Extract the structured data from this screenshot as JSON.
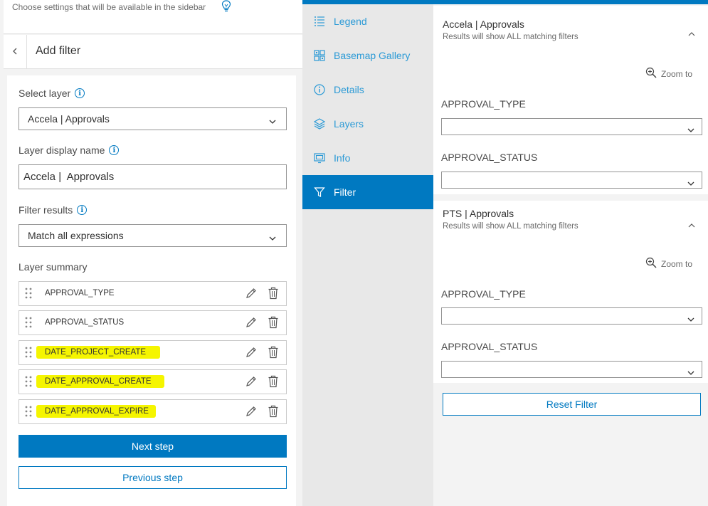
{
  "settings": {
    "hint": "Choose settings that will be available in the sidebar"
  },
  "filter_panel": {
    "title": "Add filter",
    "select_layer_label": "Select layer",
    "select_layer_value": "Accela | Approvals",
    "display_name_label": "Layer display name",
    "display_name_value": "Accela |  Approvals",
    "filter_results_label": "Filter results",
    "filter_results_value": "Match all expressions",
    "summary_label": "Layer summary",
    "expressions": [
      {
        "label": "APPROVAL_TYPE",
        "highlighted": false
      },
      {
        "label": "APPROVAL_STATUS",
        "highlighted": false
      },
      {
        "label": "DATE_PROJECT_CREATE",
        "highlighted": true
      },
      {
        "label": "DATE_APPROVAL_CREATE",
        "highlighted": true
      },
      {
        "label": "DATE_APPROVAL_EXPIRE",
        "highlighted": true
      }
    ],
    "next_label": "Next step",
    "previous_label": "Previous step",
    "highlight_color": "#f5f500",
    "accent_color": "#0079c1"
  },
  "nav": {
    "items": [
      {
        "label": "Legend",
        "icon": "legend-icon"
      },
      {
        "label": "Basemap Gallery",
        "icon": "basemap-gallery-icon"
      },
      {
        "label": "Details",
        "icon": "details-icon"
      },
      {
        "label": "Layers",
        "icon": "layers-icon"
      },
      {
        "label": "Info",
        "icon": "info-icon"
      },
      {
        "label": "Filter",
        "icon": "filter-icon",
        "active": true
      }
    ]
  },
  "filter_widget": {
    "layers": [
      {
        "title": "Accela | Approvals",
        "subtitle": "Results will show ALL matching filters",
        "zoom_label": "Zoom to",
        "fields": [
          {
            "label": "APPROVAL_TYPE",
            "value": ""
          },
          {
            "label": "APPROVAL_STATUS",
            "value": ""
          }
        ]
      },
      {
        "title": "PTS | Approvals",
        "subtitle": "Results will show ALL matching filters",
        "zoom_label": "Zoom to",
        "fields": [
          {
            "label": "APPROVAL_TYPE",
            "value": ""
          },
          {
            "label": "APPROVAL_STATUS",
            "value": ""
          }
        ]
      }
    ],
    "reset_label": "Reset Filter"
  }
}
